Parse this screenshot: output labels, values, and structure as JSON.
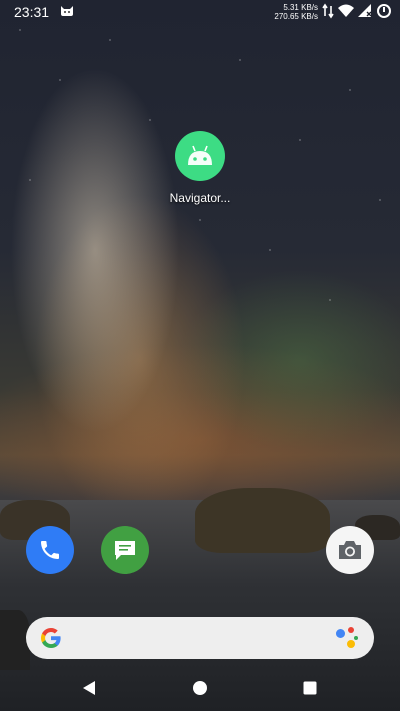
{
  "status_bar": {
    "time": "23:31",
    "upload_speed": "5.31 KB/s",
    "download_speed": "270.65 KB/s"
  },
  "home": {
    "apps": [
      {
        "label": "Navigator...",
        "icon": "android-icon",
        "color": "#3ddc84"
      }
    ]
  },
  "dock": {
    "apps": [
      {
        "name": "phone",
        "icon": "phone-icon",
        "color": "#2f7cf6"
      },
      {
        "name": "messages",
        "icon": "message-icon",
        "color": "#41a042"
      },
      {
        "name": "camera",
        "icon": "camera-icon",
        "color": "#f5f5f5"
      }
    ]
  },
  "search": {
    "logo": "google-g-icon",
    "assistant": "assistant-icon"
  },
  "nav": {
    "back": "back-icon",
    "home": "home-icon",
    "recents": "recents-icon"
  }
}
